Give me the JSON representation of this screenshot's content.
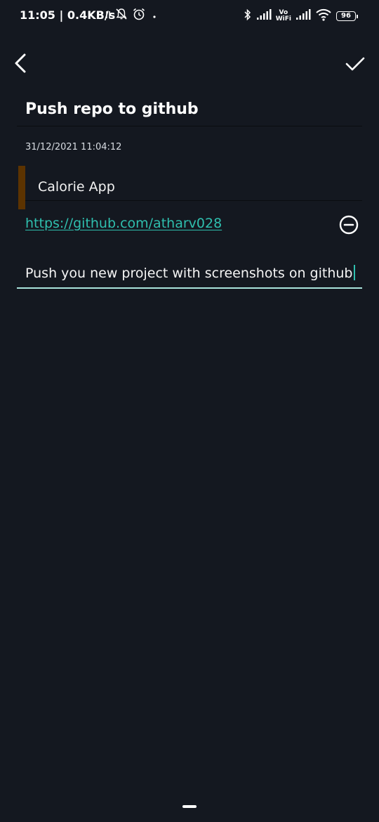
{
  "status_bar": {
    "time": "11:05 | 0.4KB/s",
    "battery": "96",
    "vowifi_top": "Vo",
    "vowifi_bottom": "WiFi"
  },
  "toolbar": {
    "back_icon": "chevron-left-icon",
    "save_icon": "check-icon"
  },
  "note": {
    "title": "Push repo to github",
    "date": "31/12/2021 11:04:12",
    "tag": "Calorie App",
    "tag_color": "#5c3300",
    "link": "https://github.com/atharv028",
    "remove_icon": "minus-circle-icon",
    "description": "Push you new project with screenshots on github"
  },
  "colors": {
    "background": "#141820",
    "accent": "#2fbfae",
    "input_underline": "#a9e4dc"
  }
}
